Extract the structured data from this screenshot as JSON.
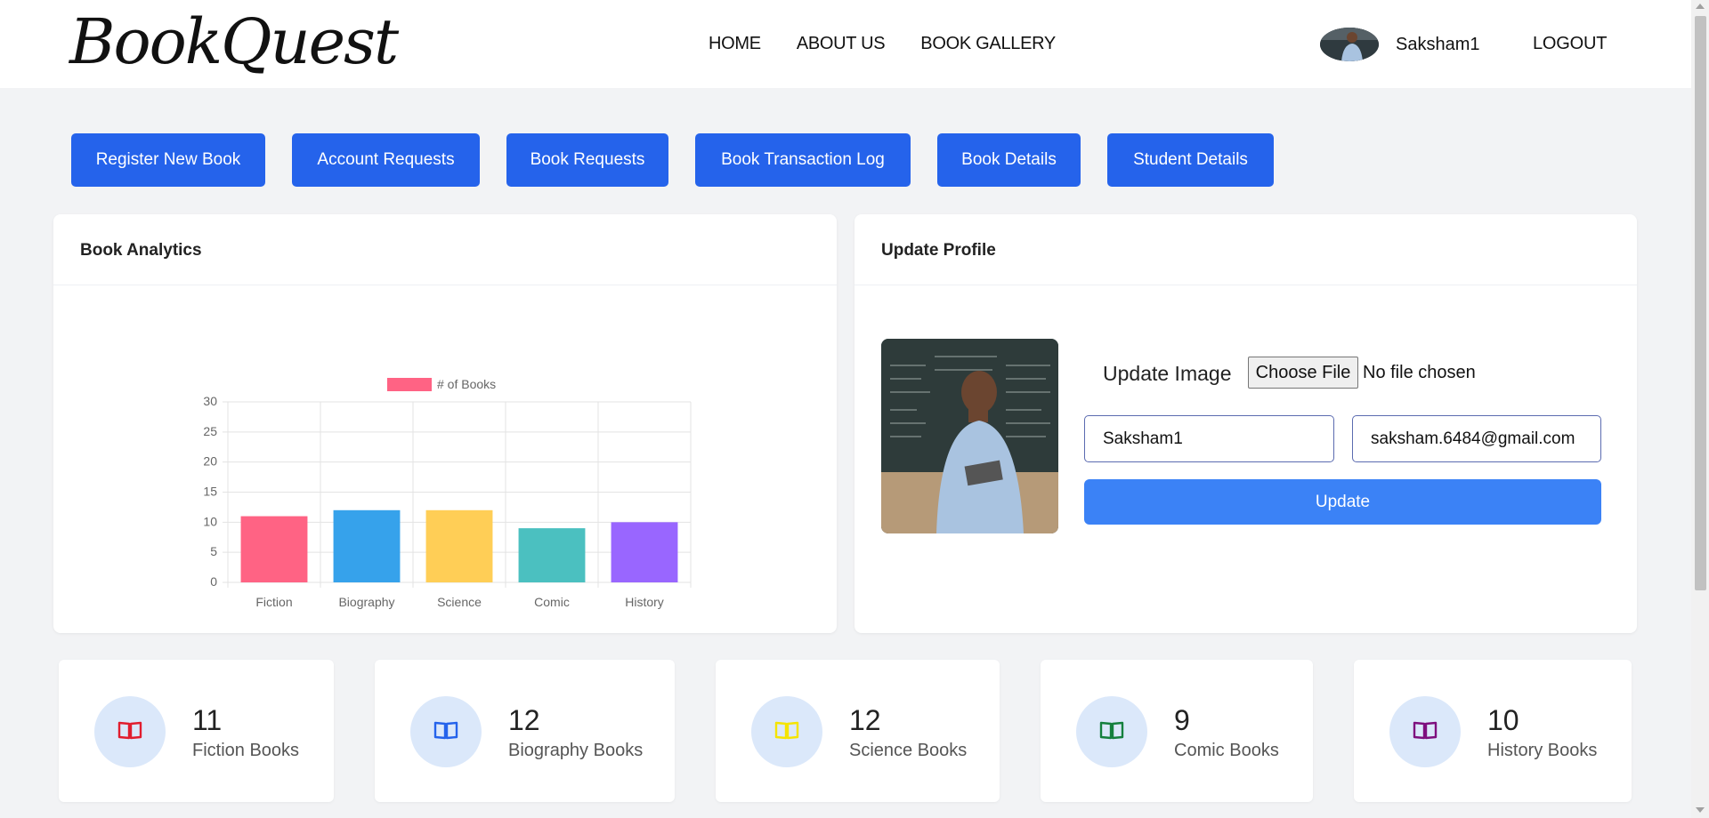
{
  "nav": {
    "logo": "BookQuest",
    "links": [
      "HOME",
      "ABOUT US",
      "BOOK GALLERY"
    ],
    "username": "Saksham1",
    "logout": "LOGOUT"
  },
  "actions": [
    "Register New Book",
    "Account Requests",
    "Book Requests",
    "Book Transaction Log",
    "Book Details",
    "Student Details"
  ],
  "analytics": {
    "title": "Book Analytics"
  },
  "chart_data": {
    "type": "bar",
    "categories": [
      "Fiction",
      "Biography",
      "Science",
      "Comic",
      "History"
    ],
    "series": [
      {
        "name": "# of Books",
        "values": [
          11,
          12,
          12,
          9,
          10
        ]
      }
    ],
    "colors": [
      "#ff6384",
      "#36a2eb",
      "#ffce56",
      "#4bc0c0",
      "#9966ff"
    ],
    "yticks": [
      "0",
      "5",
      "10",
      "15",
      "20",
      "25",
      "30"
    ],
    "ylim": [
      0,
      30
    ],
    "legend_position": "top",
    "grid": true
  },
  "profile": {
    "title": "Update Profile",
    "update_image_label": "Update Image",
    "choose_file": "Choose File",
    "no_file": "No file chosen",
    "name_value": "Saksham1",
    "email_value": "saksham.6484@gmail.com",
    "update_button": "Update"
  },
  "stats": [
    {
      "count": "11",
      "label": "Fiction Books",
      "icon": "book-icon",
      "color": "#e11d2e"
    },
    {
      "count": "12",
      "label": "Biography Books",
      "icon": "book-icon",
      "color": "#2563eb"
    },
    {
      "count": "12",
      "label": "Science Books",
      "icon": "book-icon",
      "color": "#f5e400"
    },
    {
      "count": "9",
      "label": "Comic Books",
      "icon": "book-icon",
      "color": "#15803d"
    },
    {
      "count": "10",
      "label": "History Books",
      "icon": "book-icon",
      "color": "#7e0f7e"
    }
  ]
}
